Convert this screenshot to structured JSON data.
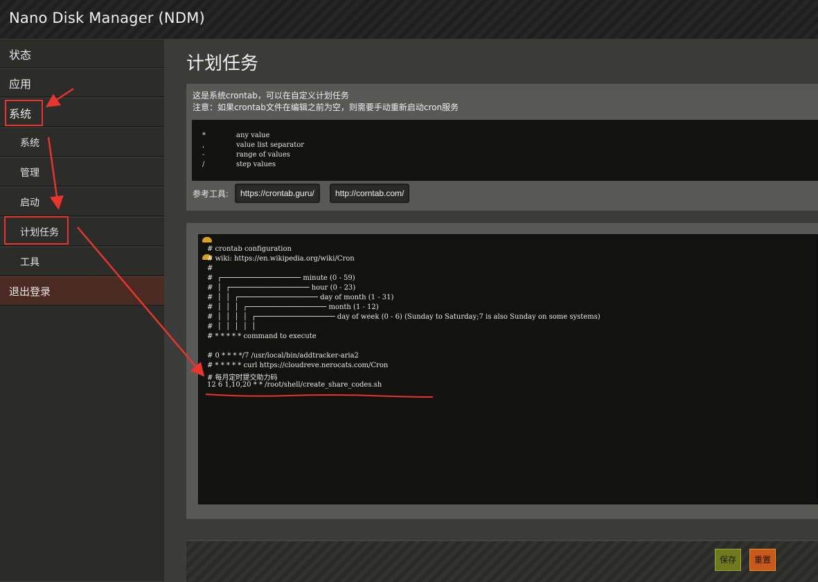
{
  "app": {
    "title": "Nano Disk Manager (NDM)"
  },
  "sidebar": {
    "items": [
      {
        "label": "状态"
      },
      {
        "label": "应用"
      },
      {
        "label": "系统"
      },
      {
        "label": "系统"
      },
      {
        "label": "管理"
      },
      {
        "label": "启动"
      },
      {
        "label": "计划任务"
      },
      {
        "label": "工具"
      },
      {
        "label": "退出登录"
      }
    ]
  },
  "main": {
    "title": "计划任务",
    "description": [
      "这是系统crontab，可以在自定义计划任务",
      "注意：如果crontab文件在编辑之前为空，则需要手动重新启动cron服务"
    ],
    "help": [
      {
        "symbol": "*",
        "text": "any value"
      },
      {
        "symbol": ",",
        "text": "value list separator"
      },
      {
        "symbol": "-",
        "text": "range of values"
      },
      {
        "symbol": "/",
        "text": "step values"
      }
    ],
    "tools_label": "参考工具:",
    "tools": [
      "https://crontab.guru/",
      "http://corntab.com/"
    ],
    "editor_lines": [
      "# crontab configuration",
      "# wiki: https://en.wikipedia.org/wiki/Cron",
      "#",
      "#  ┌─────────────────── minute (0 - 59)",
      "#  │  ┌─────────────────── hour (0 - 23)",
      "#  │  │  ┌─────────────────── day of month (1 - 31)",
      "#  │  │  │  ┌─────────────────── month (1 - 12)",
      "#  │  │  │  │  ┌─────────────────── day of week (0 - 6) (Sunday to Saturday;7 is also Sunday on some systems)",
      "#  │  │  │  │  │",
      "# * * * * * command to execute",
      "",
      "# 0 * * * */7 /usr/local/bin/addtracker-aria2",
      "# * * * * * curl https://cloudreve.nerocats.com/Cron",
      "# 每月定时提交助力码",
      "12 6 1,10,20 * * /root/shell/create_share_codes.sh"
    ],
    "save_label": "保存",
    "reset_label": "重置"
  },
  "colors": {
    "annotation": "#e8352e",
    "save": "#6e7a1e",
    "reset": "#c9591a",
    "logout_bg": "#4a2a22"
  }
}
